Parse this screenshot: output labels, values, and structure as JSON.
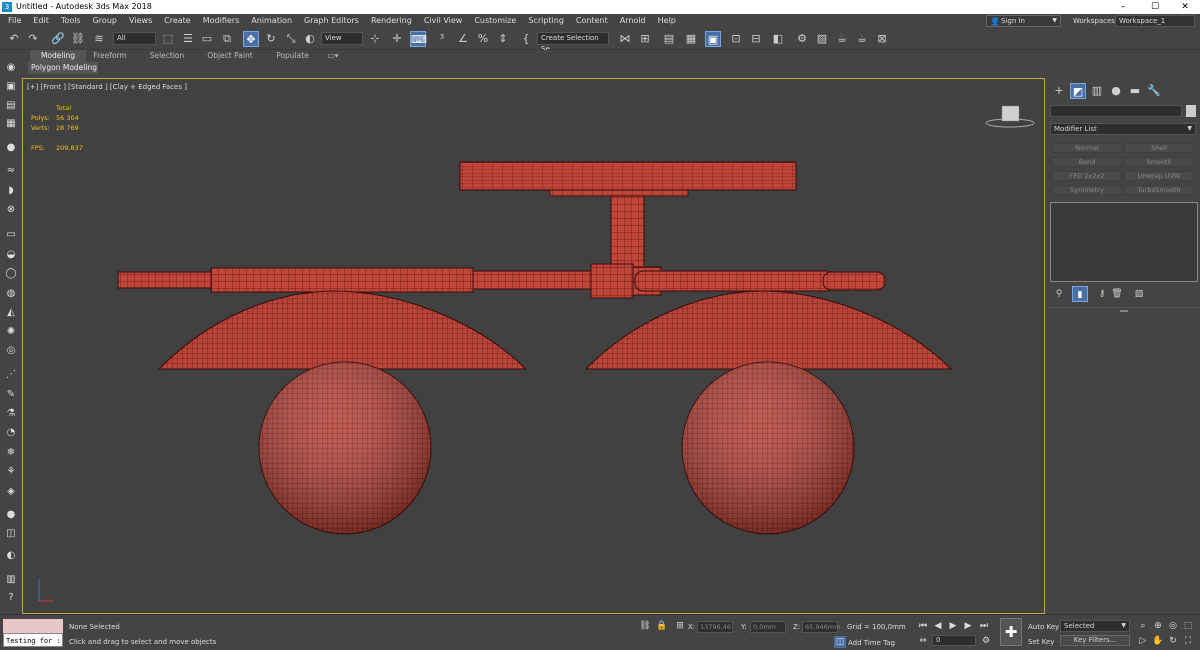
{
  "app": {
    "title": "Untitled - Autodesk 3ds Max 2018"
  },
  "window_buttons": {
    "minimize": "–",
    "maximize": "☐",
    "close": "✕"
  },
  "menu": [
    "File",
    "Edit",
    "Tools",
    "Group",
    "Views",
    "Create",
    "Modifiers",
    "Animation",
    "Graph Editors",
    "Rendering",
    "Civil View",
    "Customize",
    "Scripting",
    "Content",
    "Arnold",
    "Help"
  ],
  "account": {
    "signin": "Sign In",
    "workspaces_label": "Workspaces:",
    "workspace": "Workspace_1"
  },
  "toolbar": {
    "filter": "All",
    "refcoord": "View",
    "selection_set": "Create Selection Se"
  },
  "ribbon": {
    "tabs": [
      "Modeling",
      "Freeform",
      "Selection",
      "Object Paint",
      "Populate"
    ],
    "active": "Modeling",
    "panel": "Polygon Modeling"
  },
  "viewport": {
    "label": "[+] [Front ] [Standard ] [Clay + Edged Faces ]",
    "stats": {
      "total_label": "Total",
      "polys_label": "Polys:",
      "polys": "56 304",
      "verts_label": "Verts:",
      "verts": "28 769",
      "fps_label": "FPS:",
      "fps": "209,837"
    },
    "object_color": "#c0463a",
    "wire_color": "#5a1410"
  },
  "command_panel": {
    "modifier_list": "Modifier List",
    "modifiers": [
      "Normal",
      "Shell",
      "Bend",
      "Smooth",
      "FFD 2x2x2",
      "Unwrap UVW",
      "Symmetry",
      "TurboSmooth"
    ]
  },
  "status": {
    "maxscript": "Testing for :",
    "selected": "None Selected",
    "prompt": "Click and drag to select and move objects",
    "x_label": "X:",
    "x": "13796,46",
    "y_label": "Y:",
    "y": "0,0mm",
    "z_label": "Z:",
    "z": "65,946mm",
    "grid": "Grid = 100,0mm",
    "add_time_tag": "Add Time Tag",
    "frame": "0",
    "auto_key": "Auto Key",
    "set_key": "Set Key",
    "key_mode": "Selected",
    "key_filters": "Key Filters..."
  }
}
